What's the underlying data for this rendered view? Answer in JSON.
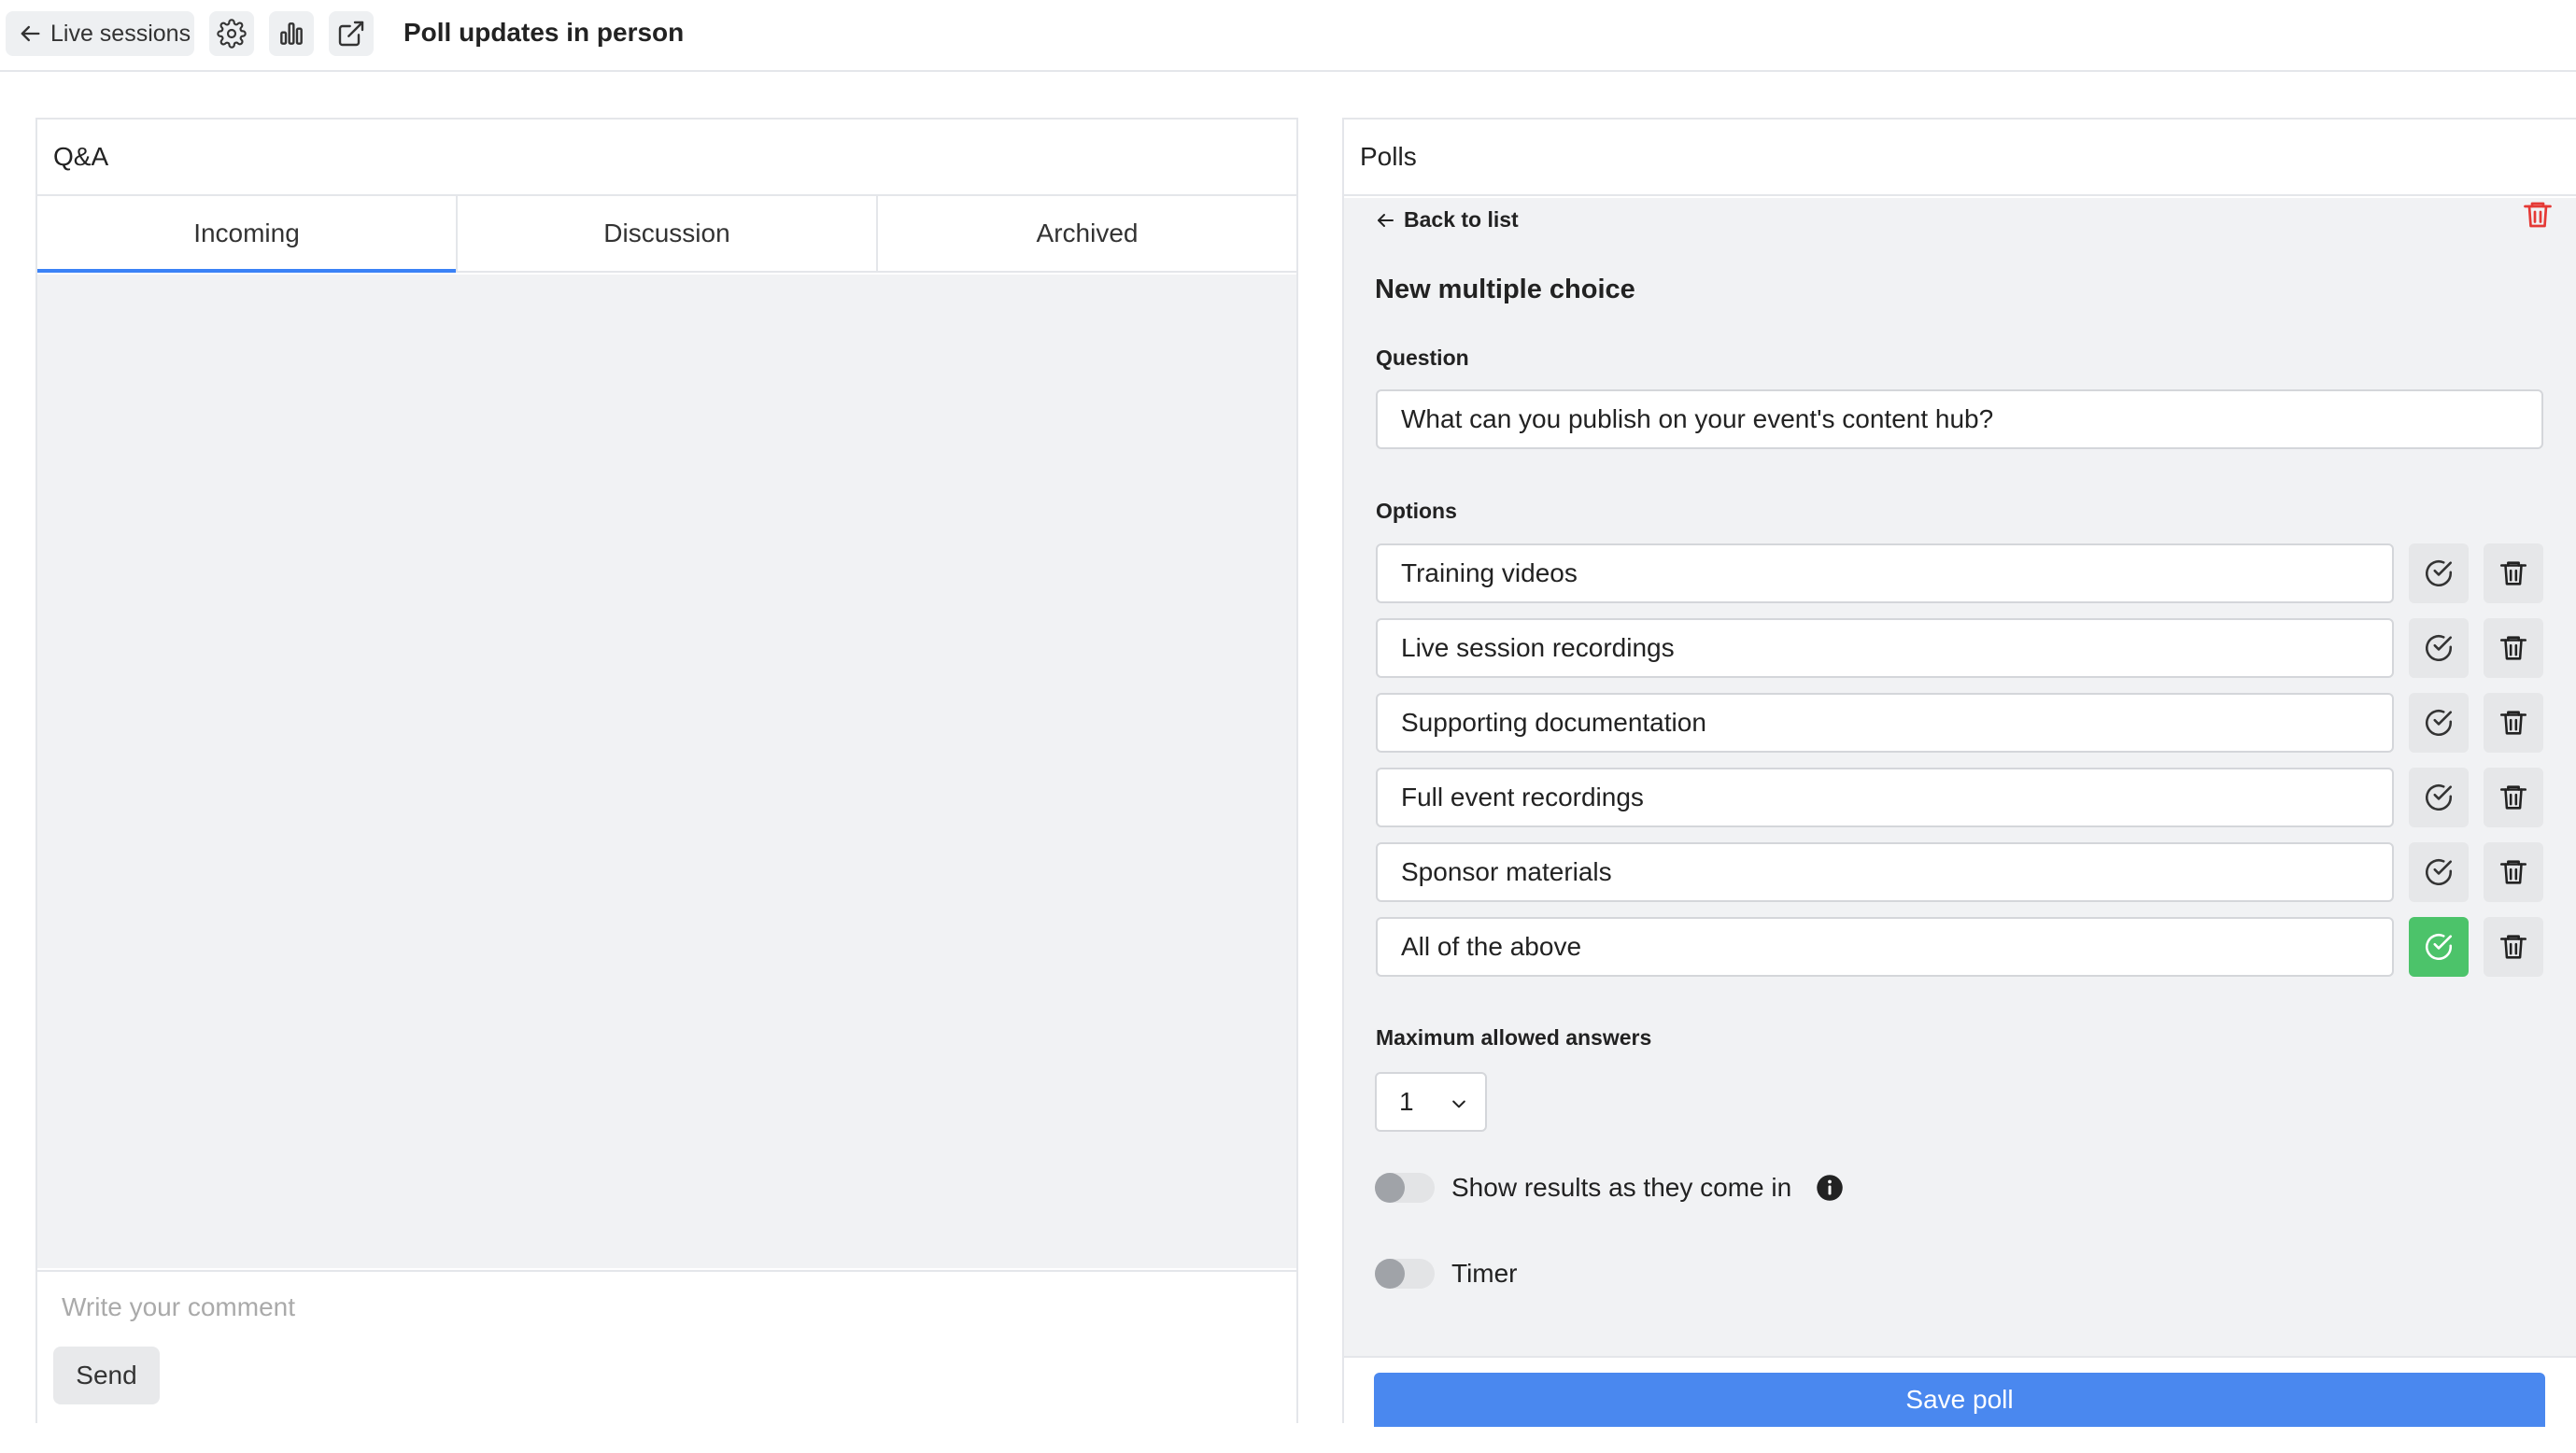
{
  "topbar": {
    "back_label": "Live sessions",
    "title": "Poll updates in person",
    "icons": [
      "arrow-left-icon",
      "gear-icon",
      "bar-chart-icon",
      "external-link-icon"
    ]
  },
  "qa": {
    "header": "Q&A",
    "tabs": [
      {
        "label": "Incoming",
        "active": true
      },
      {
        "label": "Discussion",
        "active": false
      },
      {
        "label": "Archived",
        "active": false
      }
    ],
    "comment_placeholder": "Write your comment",
    "send_label": "Send"
  },
  "polls": {
    "header": "Polls",
    "back_to_list": "Back to list",
    "heading": "New multiple choice",
    "question_label": "Question",
    "question_value": "What can you publish on your event's content hub?",
    "options_label": "Options",
    "options": [
      {
        "value": "Training videos",
        "correct": false
      },
      {
        "value": "Live session recordings",
        "correct": false
      },
      {
        "value": "Supporting documentation",
        "correct": false
      },
      {
        "value": "Full event recordings",
        "correct": false
      },
      {
        "value": "Sponsor materials",
        "correct": false
      },
      {
        "value": "All of the above",
        "correct": true
      }
    ],
    "max_answers_label": "Maximum allowed answers",
    "max_answers_value": "1",
    "show_results_label": "Show results as they come in",
    "show_results_on": false,
    "timer_label": "Timer",
    "timer_on": false,
    "save_label": "Save poll"
  },
  "colors": {
    "accent": "#3b82f6",
    "save_button": "#4a88ef",
    "correct_green": "#4cc36a",
    "delete_red": "#e53935"
  }
}
